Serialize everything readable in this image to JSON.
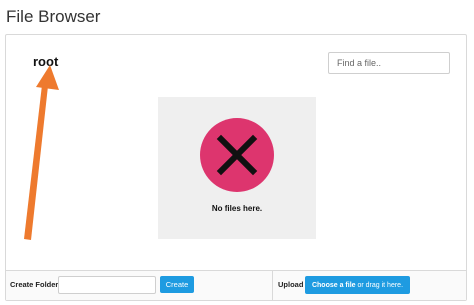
{
  "header": {
    "title": "File Browser"
  },
  "browser": {
    "breadcrumb_root": "root",
    "search": {
      "placeholder": "Find a file..",
      "value": ""
    },
    "empty_state": {
      "message": "No files here.",
      "icon": "close-x-icon"
    }
  },
  "footer": {
    "create_folder_label": "Create Folder",
    "folder_name_value": "",
    "create_button_label": "Create",
    "upload_label": "Upload",
    "upload_button_strong": "Choose a file",
    "upload_button_rest": " or drag it here."
  },
  "colors": {
    "accent": "#1e9be1",
    "empty_icon_circle": "#dd356e",
    "annotation_arrow": "#ee7a2e"
  }
}
